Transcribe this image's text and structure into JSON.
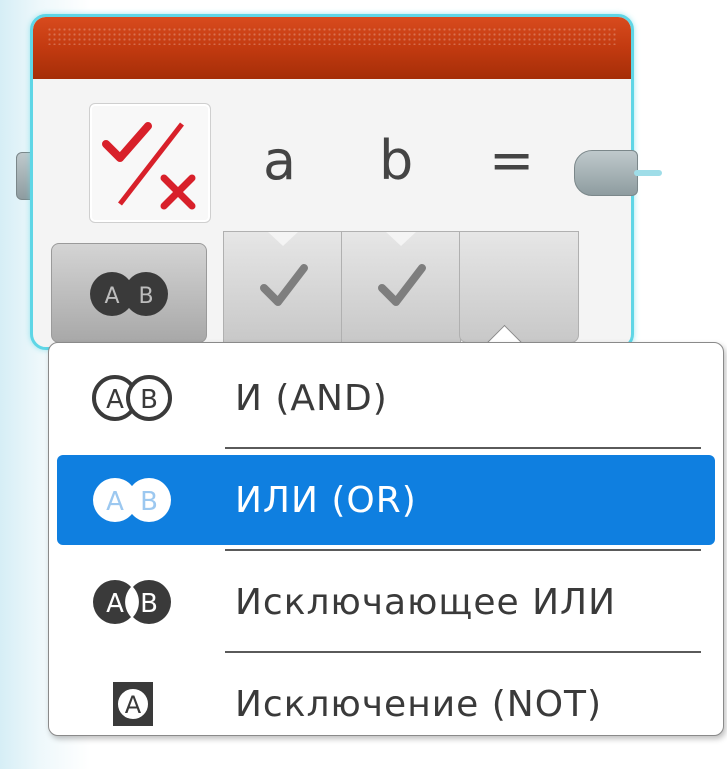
{
  "block": {
    "params": [
      "a",
      "b",
      "="
    ],
    "accent": "#5fd6e6",
    "header_color": "#c23a10"
  },
  "mode_selector": {
    "icons": [
      "A",
      "B"
    ]
  },
  "menu": {
    "selected_color": "#0f7fe0",
    "items": [
      {
        "label": "И (AND)",
        "icon": "and-icon",
        "letters": [
          "A",
          "B"
        ],
        "selected": false
      },
      {
        "label": "ИЛИ (OR)",
        "icon": "or-icon",
        "letters": [
          "A",
          "B"
        ],
        "selected": true
      },
      {
        "label": "Исключающее ИЛИ",
        "icon": "xor-icon",
        "letters": [
          "A",
          "B"
        ],
        "selected": false
      },
      {
        "label": "Исключение (NOT)",
        "icon": "not-icon",
        "letters": [
          "A"
        ],
        "selected": false
      }
    ]
  }
}
